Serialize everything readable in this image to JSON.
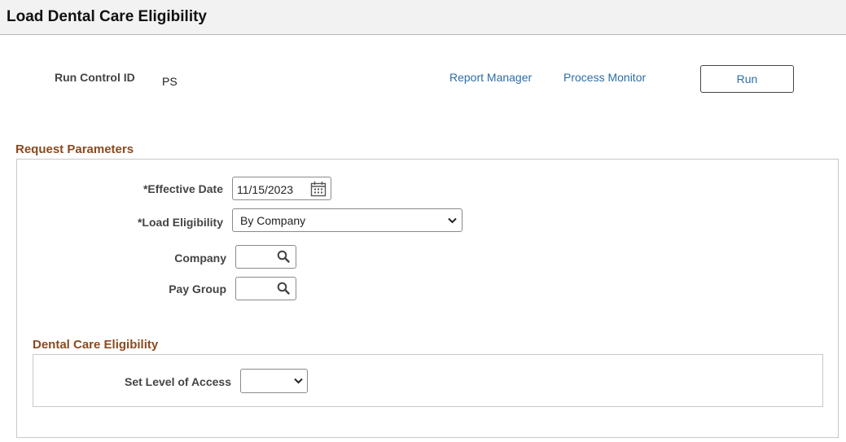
{
  "header": {
    "title": "Load Dental Care Eligibility"
  },
  "run_control": {
    "label": "Run Control ID",
    "value": "PS",
    "report_manager": "Report Manager",
    "process_monitor": "Process Monitor",
    "run_label": "Run"
  },
  "request_parameters": {
    "title": "Request Parameters",
    "effective_date": {
      "label": "*Effective Date",
      "value": "11/15/2023"
    },
    "load_eligibility": {
      "label": "*Load Eligibility",
      "value": "By Company"
    },
    "company": {
      "label": "Company",
      "value": ""
    },
    "pay_group": {
      "label": "Pay Group",
      "value": ""
    }
  },
  "dental_care": {
    "title": "Dental Care Eligibility",
    "set_level_of_access": {
      "label": "Set Level of Access",
      "value": ""
    }
  },
  "icons": {
    "calendar": "calendar-icon",
    "search": "search-icon",
    "dropdown": "chevron-down-icon"
  }
}
